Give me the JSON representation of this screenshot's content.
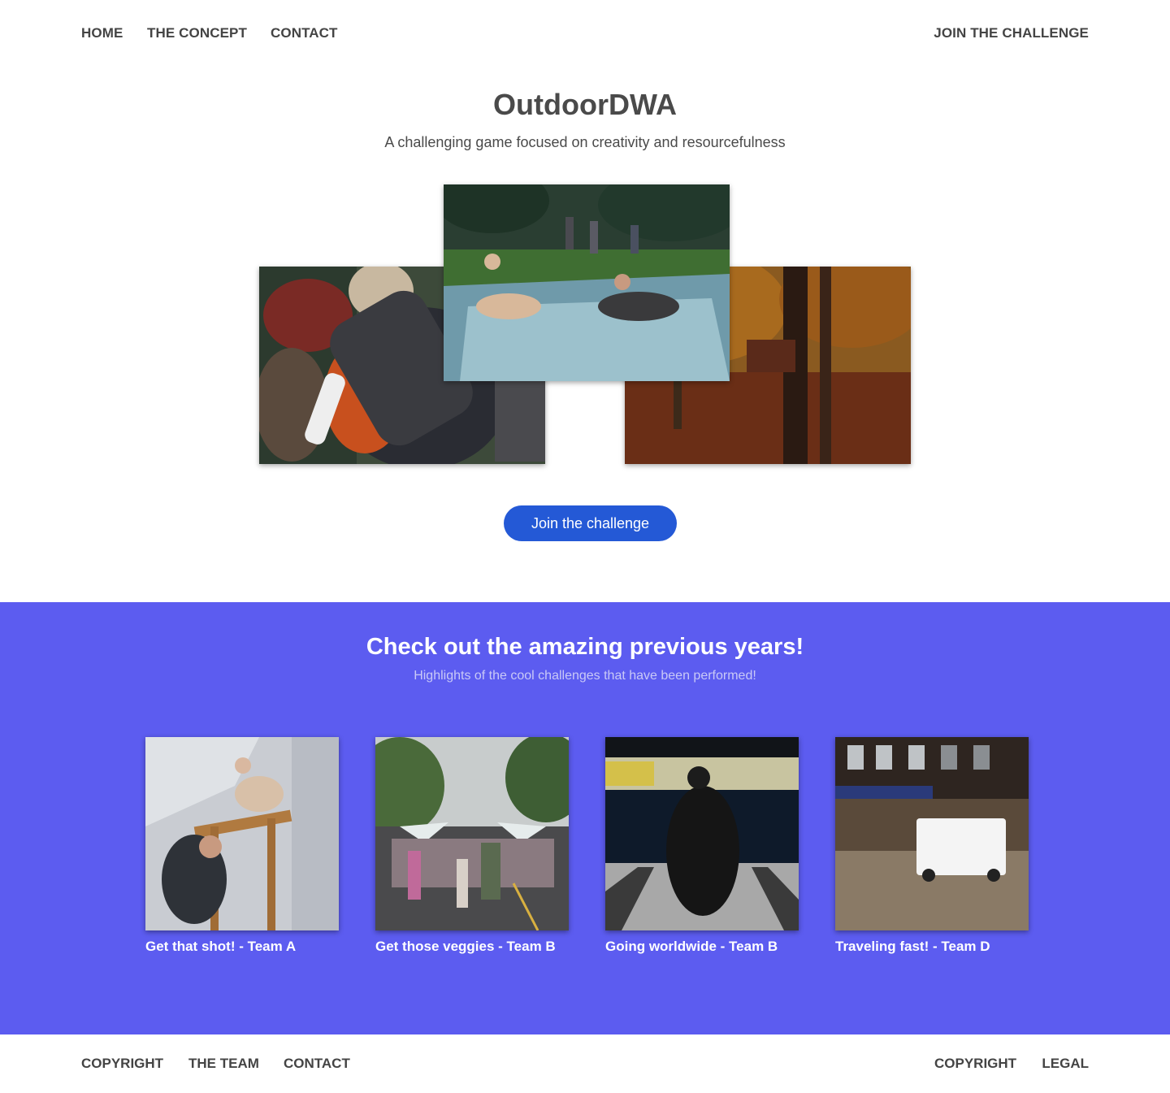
{
  "nav": {
    "home": "HOME",
    "concept": "THE CONCEPT",
    "contact": "CONTACT",
    "join": "JOIN THE CHALLENGE"
  },
  "hero": {
    "title": "OutdoorDWA",
    "subtitle": "A challenging game focused on creativity and resourcefulness",
    "cta": "Join the challenge"
  },
  "previous": {
    "title": "Check out the amazing previous years!",
    "subtitle": "Highlights of the cool challenges that have been performed!",
    "cards": [
      {
        "caption": "Get that shot! - Team A"
      },
      {
        "caption": "Get those veggies - Team B"
      },
      {
        "caption": "Going worldwide - Team B"
      },
      {
        "caption": "Traveling fast! - Team D"
      }
    ]
  },
  "footer": {
    "copyright_left": "COPYRIGHT",
    "team": "THE TEAM",
    "contact": "CONTACT",
    "copyright_right": "COPYRIGHT",
    "legal": "LEGAL"
  },
  "colors": {
    "accent_band": "#5c5cf0",
    "cta_button": "#2459d6",
    "nav_text": "#444444"
  }
}
